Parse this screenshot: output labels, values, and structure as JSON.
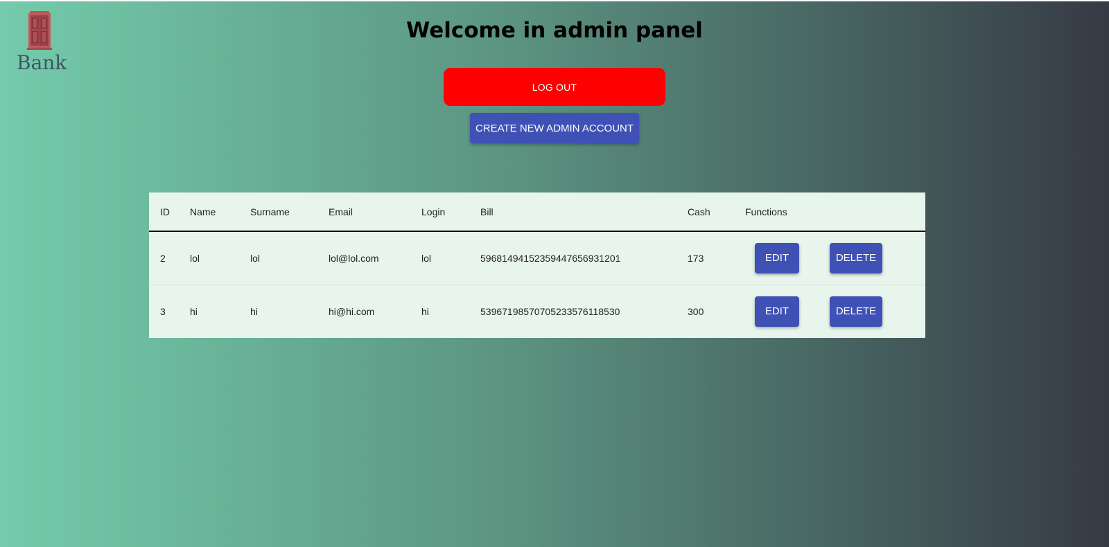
{
  "logo": {
    "icon": "building-door-icon",
    "text": "Bank"
  },
  "header": {
    "title": "Welcome in admin panel"
  },
  "buttons": {
    "logout_label": "LOG OUT",
    "create_admin_label": "CREATE NEW ADMIN ACCOUNT"
  },
  "table": {
    "columns": [
      "ID",
      "Name",
      "Surname",
      "Email",
      "Login",
      "Bill",
      "Cash",
      "Functions"
    ],
    "rows": [
      {
        "id": "2",
        "name": "lol",
        "surname": "lol",
        "email": "lol@lol.com",
        "login": "lol",
        "bill": "59681494152359447656931201",
        "cash": "173",
        "edit_label": "EDIT",
        "delete_label": "DELETE"
      },
      {
        "id": "3",
        "name": "hi",
        "surname": "hi",
        "email": "hi@hi.com",
        "login": "hi",
        "bill": "53967198570705233576118530",
        "cash": "300",
        "edit_label": "EDIT",
        "delete_label": "DELETE"
      }
    ]
  },
  "colors": {
    "logout": "#ff0000",
    "primary": "#3f51b5",
    "table_bg": "#e8f5ec",
    "gradient_start": "#74cbac",
    "gradient_end": "#363a45"
  }
}
